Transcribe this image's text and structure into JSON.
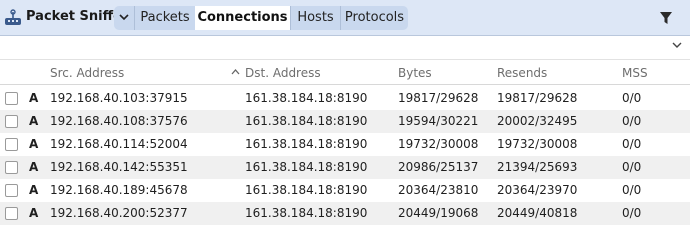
{
  "toolbar": {
    "app_title": "Packet Sniffer",
    "tabs": [
      {
        "label": "Packets",
        "active": false
      },
      {
        "label": "Connections",
        "active": true
      },
      {
        "label": "Hosts",
        "active": false
      },
      {
        "label": "Protocols",
        "active": false
      }
    ],
    "icons": [
      "packet-sniffer-app-icon",
      "chevron-down-icon",
      "filter-icon",
      "chevron-down-icon"
    ],
    "accent_color": "#dde7f6",
    "active_tab_color": "#ffffff"
  },
  "table": {
    "columns": [
      "Src. Address",
      "Dst. Address",
      "Bytes",
      "Resends",
      "MSS"
    ],
    "sorted_column": "Dst. Address",
    "sort_direction": "ascending",
    "rows": [
      {
        "proto": "A",
        "src": "192.168.40.103:37915",
        "dst": "161.38.184.18:8190",
        "bytes": "19817/29628",
        "resends": "19817/29628",
        "mss": "0/0"
      },
      {
        "proto": "A",
        "src": "192.168.40.108:37576",
        "dst": "161.38.184.18:8190",
        "bytes": "19594/30221",
        "resends": "20002/32495",
        "mss": "0/0"
      },
      {
        "proto": "A",
        "src": "192.168.40.114:52004",
        "dst": "161.38.184.18:8190",
        "bytes": "19732/30008",
        "resends": "19732/30008",
        "mss": "0/0"
      },
      {
        "proto": "A",
        "src": "192.168.40.142:55351",
        "dst": "161.38.184.18:8190",
        "bytes": "20986/25137",
        "resends": "21394/25693",
        "mss": "0/0"
      },
      {
        "proto": "A",
        "src": "192.168.40.189:45678",
        "dst": "161.38.184.18:8190",
        "bytes": "20364/23810",
        "resends": "20364/23970",
        "mss": "0/0"
      },
      {
        "proto": "A",
        "src": "192.168.40.200:52377",
        "dst": "161.38.184.18:8190",
        "bytes": "20449/19068",
        "resends": "20449/40818",
        "mss": "0/0"
      }
    ]
  }
}
